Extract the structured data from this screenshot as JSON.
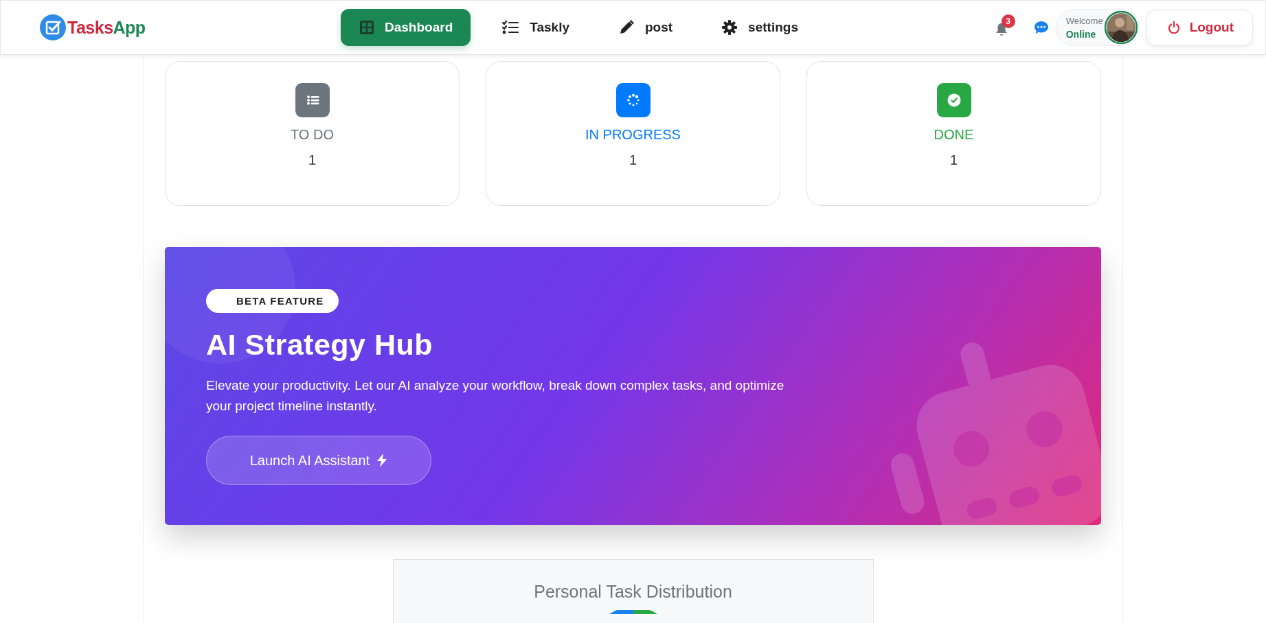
{
  "header": {
    "brand": [
      "Tasks",
      "App"
    ],
    "nav": [
      {
        "label": "Dashboard",
        "selected": true
      },
      {
        "label": "Taskly",
        "selected": false
      },
      {
        "label": "post",
        "selected": false
      },
      {
        "label": "settings",
        "selected": false
      }
    ],
    "notifications": {
      "count": "3"
    },
    "user": {
      "greeting": "Welcome",
      "status": "Online"
    },
    "logout": "Logout"
  },
  "stats": [
    {
      "label": "TO DO",
      "count": "1",
      "color": "#6c757d"
    },
    {
      "label": "IN PROGRESS",
      "count": "1",
      "color": "#007bff"
    },
    {
      "label": "DONE",
      "count": "1",
      "color": "#28a745"
    }
  ],
  "banner": {
    "badge": "BETA FEATURE",
    "title": "AI Strategy Hub",
    "text": "Elevate your productivity. Let our AI analyze your workflow, break down complex tasks, and optimize your project timeline instantly.",
    "button": "Launch AI Assistant"
  },
  "chart_card": {
    "title": "Personal Task Distribution"
  }
}
